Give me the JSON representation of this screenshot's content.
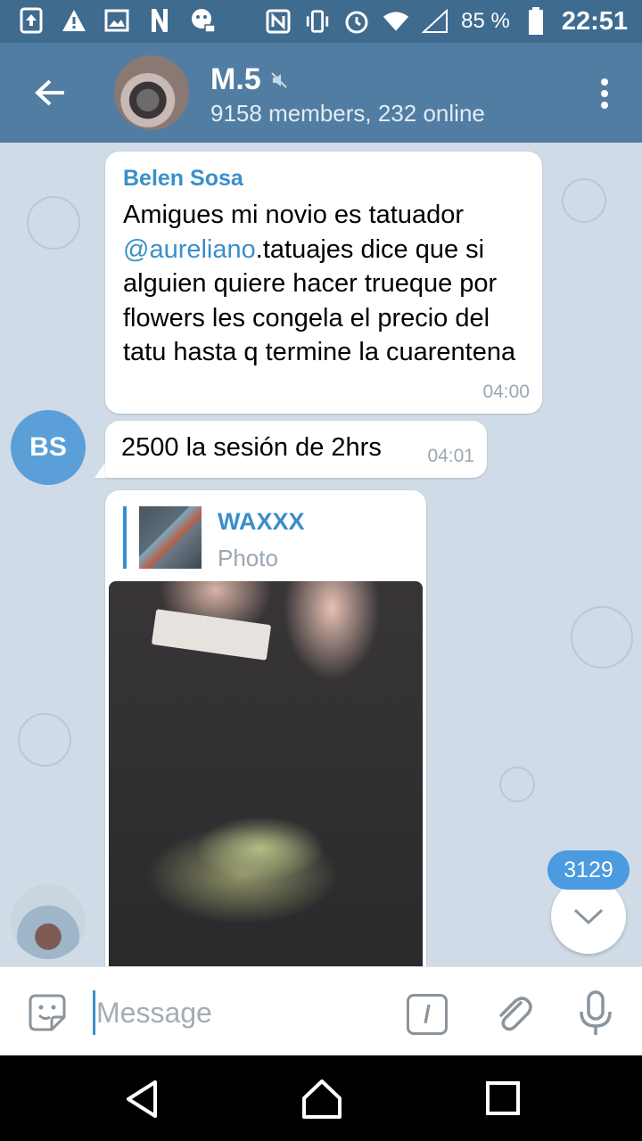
{
  "status_bar": {
    "battery_percent": "85 %",
    "time": "22:51",
    "icons": [
      "upload-icon",
      "warning-icon",
      "image-icon",
      "n-logo-icon",
      "bug-icon",
      "nfc-icon",
      "vibrate-icon",
      "alarm-icon",
      "wifi-icon",
      "signal-icon",
      "battery-icon"
    ]
  },
  "header": {
    "title": "M.5",
    "subtitle": "9158 members, 232 online",
    "muted_icon": "muted-icon"
  },
  "messages": [
    {
      "sender": "Belen Sosa",
      "text_before": "Amigues mi novio es tatuador ",
      "mention": "@aureliano",
      "text_after": ".tatuajes dice que si alguien quiere hacer trueque por flowers les congela el precio del tatu hasta q termine la cuarentena",
      "time": "04:00"
    },
    {
      "avatar_initials": "BS",
      "text": "2500 la sesión de 2hrs",
      "time": "04:01"
    },
    {
      "reply_name": "WAXXX",
      "reply_label": "Photo"
    }
  ],
  "scroll_badge": "3129",
  "input": {
    "placeholder": "Message",
    "command_glyph": "/"
  },
  "colors": {
    "header": "#517da2",
    "status_bar": "#3f6b8f",
    "accent": "#3a8fca",
    "chat_bg": "#cfdbe6"
  }
}
